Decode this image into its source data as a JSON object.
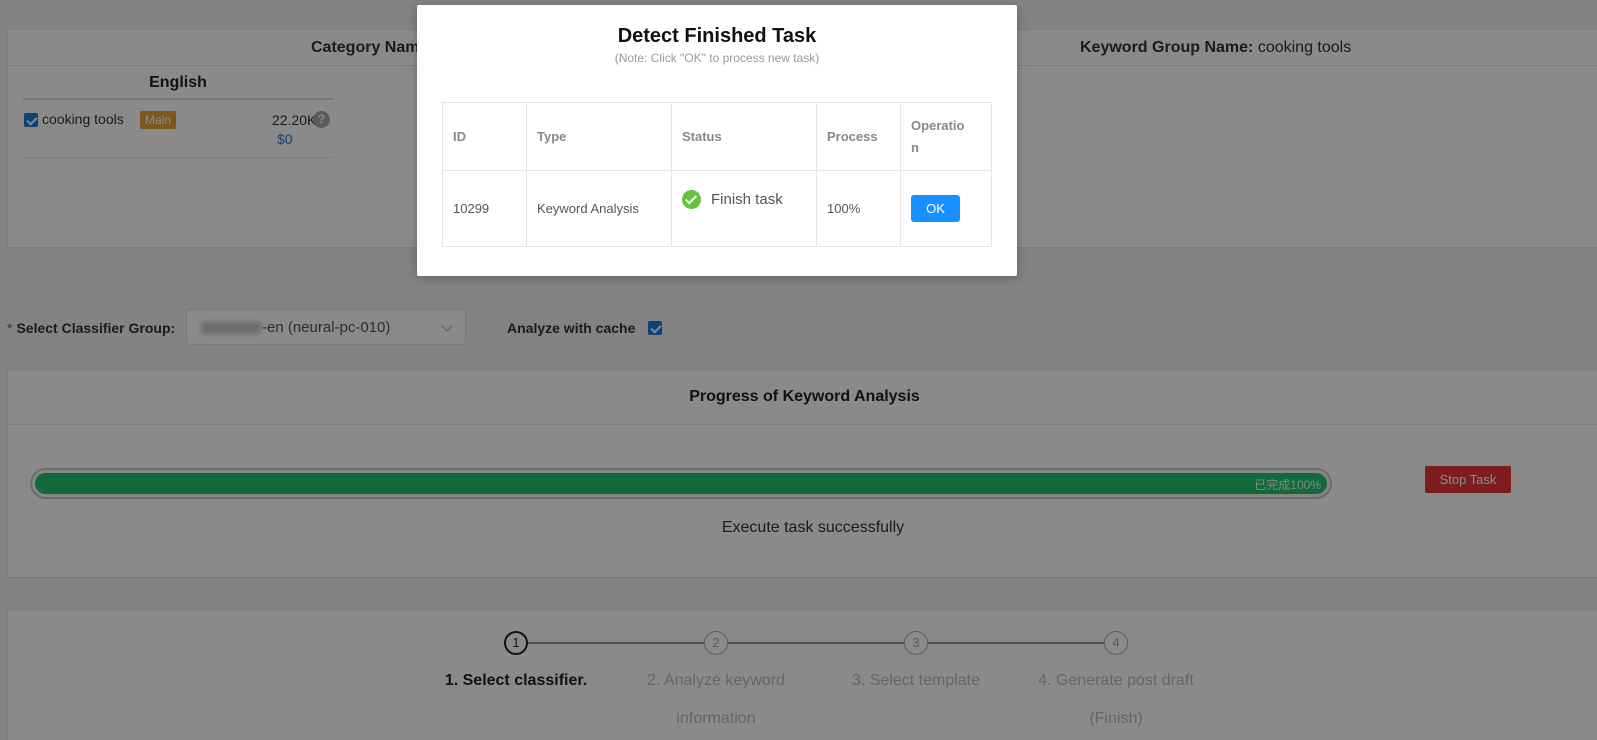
{
  "top_card": {
    "category_label": "Category Name",
    "keyword_group_label": "Keyword Group Name:",
    "keyword_group_value": "cooking tools",
    "language_title": "English",
    "keyword": {
      "name": "cooking tools",
      "tag": "Main",
      "volume": "22.20K",
      "price": "$0",
      "help_glyph": "?"
    }
  },
  "classifier": {
    "required_mark": "*",
    "label": "Select Classifier Group:",
    "selected_value": "-en (neural-pc-010)",
    "cache_label": "Analyze with cache",
    "cache_checked": true
  },
  "progress": {
    "title": "Progress of Keyword Analysis",
    "percent": 100,
    "percent_text": "已完成100%",
    "stop_label": "Stop Task",
    "message": "Execute task successfully"
  },
  "steps": [
    {
      "num": "1",
      "label": "1. Select classifier.",
      "active": true
    },
    {
      "num": "2",
      "label": "2. Analyze keyword information",
      "active": false
    },
    {
      "num": "3",
      "label": "3. Select template",
      "active": false
    },
    {
      "num": "4",
      "label": "4. Generate post draft (Finish)",
      "active": false
    }
  ],
  "modal": {
    "title": "Detect Finished Task",
    "note": "(Note: Click \"OK\" to process new task)",
    "columns": {
      "id": "ID",
      "type": "Type",
      "status": "Status",
      "process": "Process",
      "operation_a": "Operatio",
      "operation_b": "n"
    },
    "row": {
      "id": "10299",
      "type": "Keyword Analysis",
      "status": "Finish task",
      "status_icon": "check-circle-icon",
      "process": "100%",
      "ok_label": "OK"
    }
  },
  "colors": {
    "accent": "#1890ff",
    "success": "#26c26d",
    "danger": "#e53935",
    "tag": "#e6a23c"
  }
}
